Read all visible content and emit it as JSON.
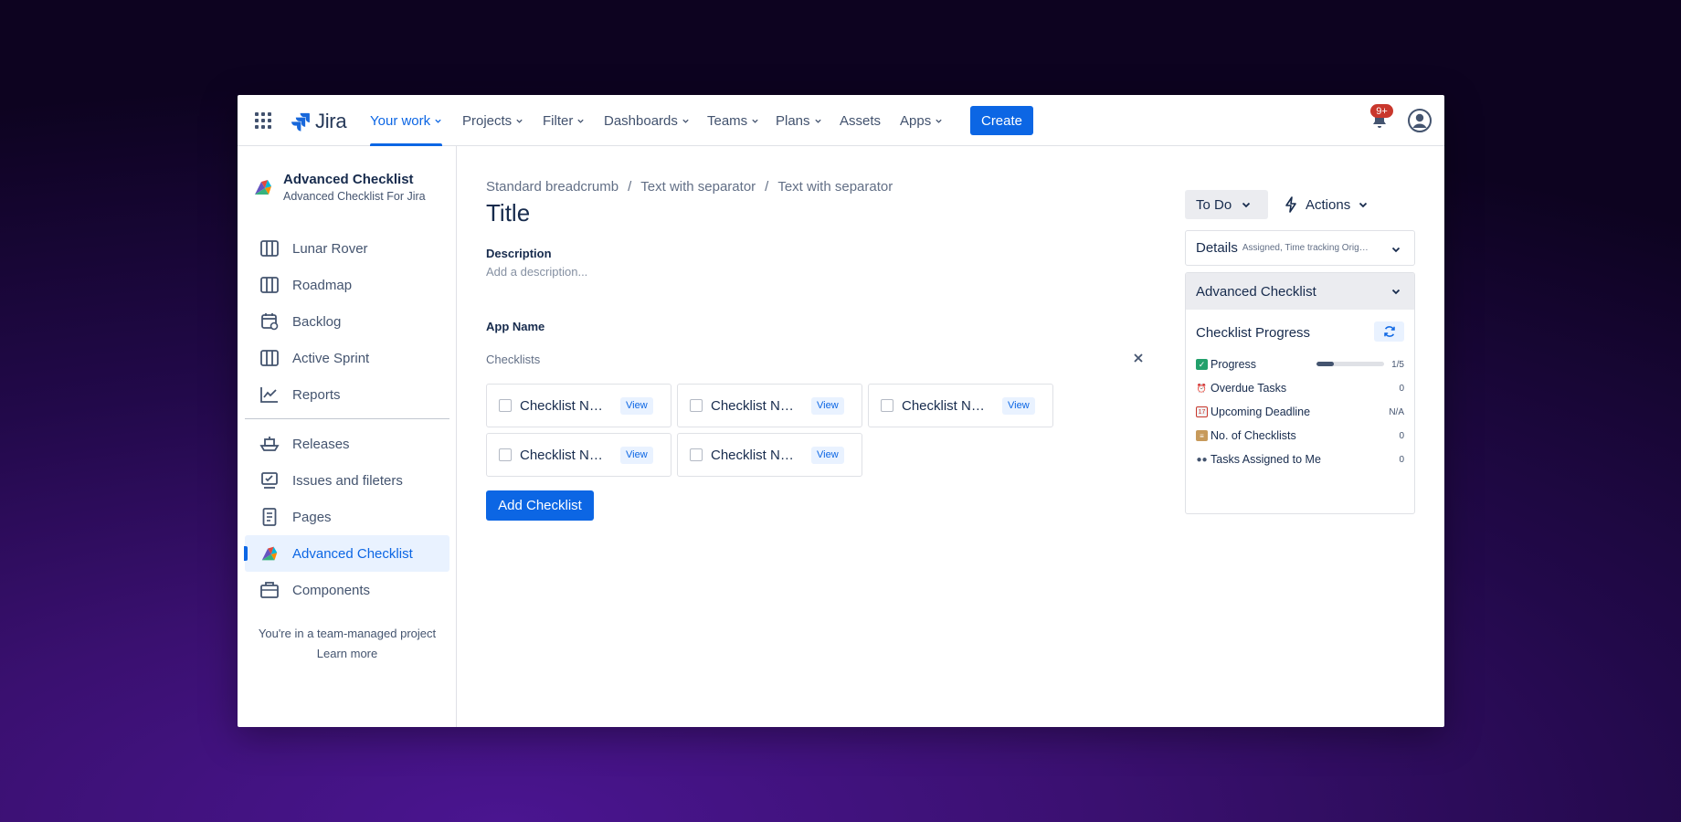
{
  "topnav": {
    "logo_text": "Jira",
    "items": [
      {
        "label": "Your work",
        "active": true
      },
      {
        "label": "Projects"
      },
      {
        "label": "Filter"
      },
      {
        "label": "Dashboards"
      },
      {
        "label": "Teams"
      },
      {
        "label": "Plans"
      },
      {
        "label": "Assets"
      },
      {
        "label": "Apps"
      }
    ],
    "create_label": "Create",
    "notification_count": "9+"
  },
  "sidebar": {
    "project_title": "Advanced Checklist",
    "project_subtitle": "Advanced Checklist For Jira",
    "items": [
      {
        "label": "Lunar Rover",
        "icon": "board-icon"
      },
      {
        "label": "Roadmap",
        "icon": "board-icon"
      },
      {
        "label": "Backlog",
        "icon": "calendar-icon"
      },
      {
        "label": "Active Sprint",
        "icon": "board-icon"
      },
      {
        "label": "Reports",
        "icon": "chart-line-icon"
      },
      {
        "label": "Releases",
        "icon": "ship-icon"
      },
      {
        "label": "Issues and fileters",
        "icon": "issues-icon"
      },
      {
        "label": "Pages",
        "icon": "page-icon"
      },
      {
        "label": "Advanced Checklist",
        "icon": "app-logo-icon",
        "selected": true
      },
      {
        "label": "Components",
        "icon": "component-icon"
      }
    ],
    "footer_text": "You're in a team-managed project",
    "learn_more": "Learn more"
  },
  "main": {
    "breadcrumbs": [
      "Standard breadcrumb",
      "Text with separator",
      "Text with separator"
    ],
    "breadcrumb_separator": "/",
    "title": "Title",
    "description_label": "Description",
    "description_placeholder": "Add a description...",
    "app_name": "App Name",
    "checklists_label": "Checklists",
    "checklists": [
      {
        "name": "Checklist Name",
        "view": "View"
      },
      {
        "name": "Checklist Name",
        "view": "View"
      },
      {
        "name": "Checklist Name",
        "view": "View"
      },
      {
        "name": "Checklist Name",
        "view": "View"
      },
      {
        "name": "Checklist Name",
        "view": "View"
      }
    ],
    "add_checklist_label": "Add Checklist"
  },
  "panel": {
    "status_label": "To Do",
    "actions_label": "Actions",
    "details_title": "Details",
    "details_subtitle": "Assigned, Time tracking Original estimate",
    "advanced_checklist_title": "Advanced Checklist",
    "progress_title": "Checklist Progress",
    "stats": [
      {
        "emoji": "✅",
        "label": "Progress",
        "value": "1/5",
        "progress": 0.25
      },
      {
        "emoji": "⏰",
        "label": "Overdue Tasks",
        "value": "0"
      },
      {
        "emoji": "📅",
        "label": "Upcoming Deadline",
        "value": "N/A"
      },
      {
        "emoji": "📋",
        "label": "No. of Checklists",
        "value": "0"
      },
      {
        "emoji": "👥",
        "label": "Tasks Assigned to Me",
        "value": "0"
      }
    ]
  },
  "colors": {
    "accent": "#0c66e4",
    "badge": "#c9372c",
    "background_gradient": "#3a1070"
  }
}
